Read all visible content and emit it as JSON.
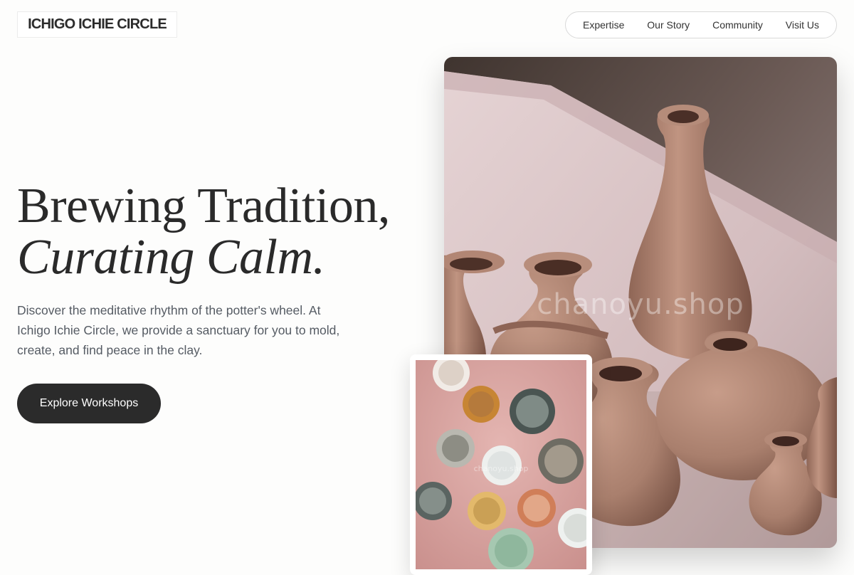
{
  "brand": {
    "name": "ICHIGO ICHIE CIRCLE"
  },
  "nav": {
    "items": [
      "Expertise",
      "Our Story",
      "Community",
      "Visit Us"
    ]
  },
  "hero": {
    "title_line1": "Brewing Tradition,",
    "title_line2": "Curating Calm.",
    "description": "Discover the meditative rhythm of the potter's wheel. At Ichigo Ichie Circle, we provide a sanctuary for you to mold, create, and find peace in the clay.",
    "cta_label": "Explore Workshops"
  },
  "media": {
    "main_image_watermark": "chanoyu.shop",
    "secondary_image_watermark": "chanoyu.shop"
  },
  "colors": {
    "cta_background": "#2b2b2b",
    "clay": "#b48a78",
    "tabletop": "#d7c2c4",
    "secondary_background": "#d9a9a6"
  }
}
